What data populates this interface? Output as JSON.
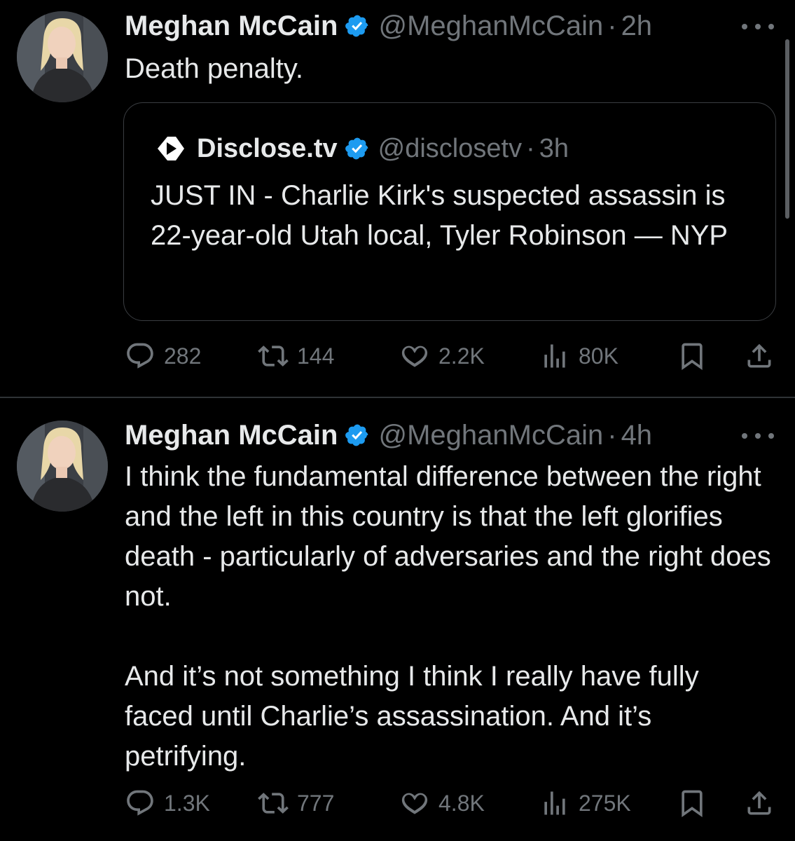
{
  "tweets": [
    {
      "name": "Meghan McCain",
      "handle": "@MeghanMcCain",
      "time": "2h",
      "text": "Death penalty.",
      "quote": {
        "name": "Disclose.tv",
        "handle": "@disclosetv",
        "time": "3h",
        "text": "JUST IN - Charlie Kirk's suspected assassin is 22-year-old Utah local, Tyler Robinson — NYP"
      },
      "replies": "282",
      "reposts": "144",
      "likes": "2.2K",
      "views": "80K"
    },
    {
      "name": "Meghan McCain",
      "handle": "@MeghanMcCain",
      "time": "4h",
      "text": "I think the fundamental difference between the right and the left in this country is that the left glorifies death - particularly of adversaries and the right does not.\n\nAnd it’s not something I think I really have fully faced until Charlie’s assassination. And it’s petrifying.",
      "replies": "1.3K",
      "reposts": "777",
      "likes": "4.8K",
      "views": "275K"
    }
  ],
  "colors": {
    "background": "#000000",
    "text": "#e7e9ea",
    "secondary": "#71767b",
    "verified": "#1d9bf0",
    "divider": "#2f3336"
  },
  "icons": [
    "verified-badge-icon",
    "more-icon",
    "disclose-logo-icon",
    "reply-icon",
    "repost-icon",
    "like-icon",
    "views-icon",
    "bookmark-icon",
    "share-icon"
  ]
}
